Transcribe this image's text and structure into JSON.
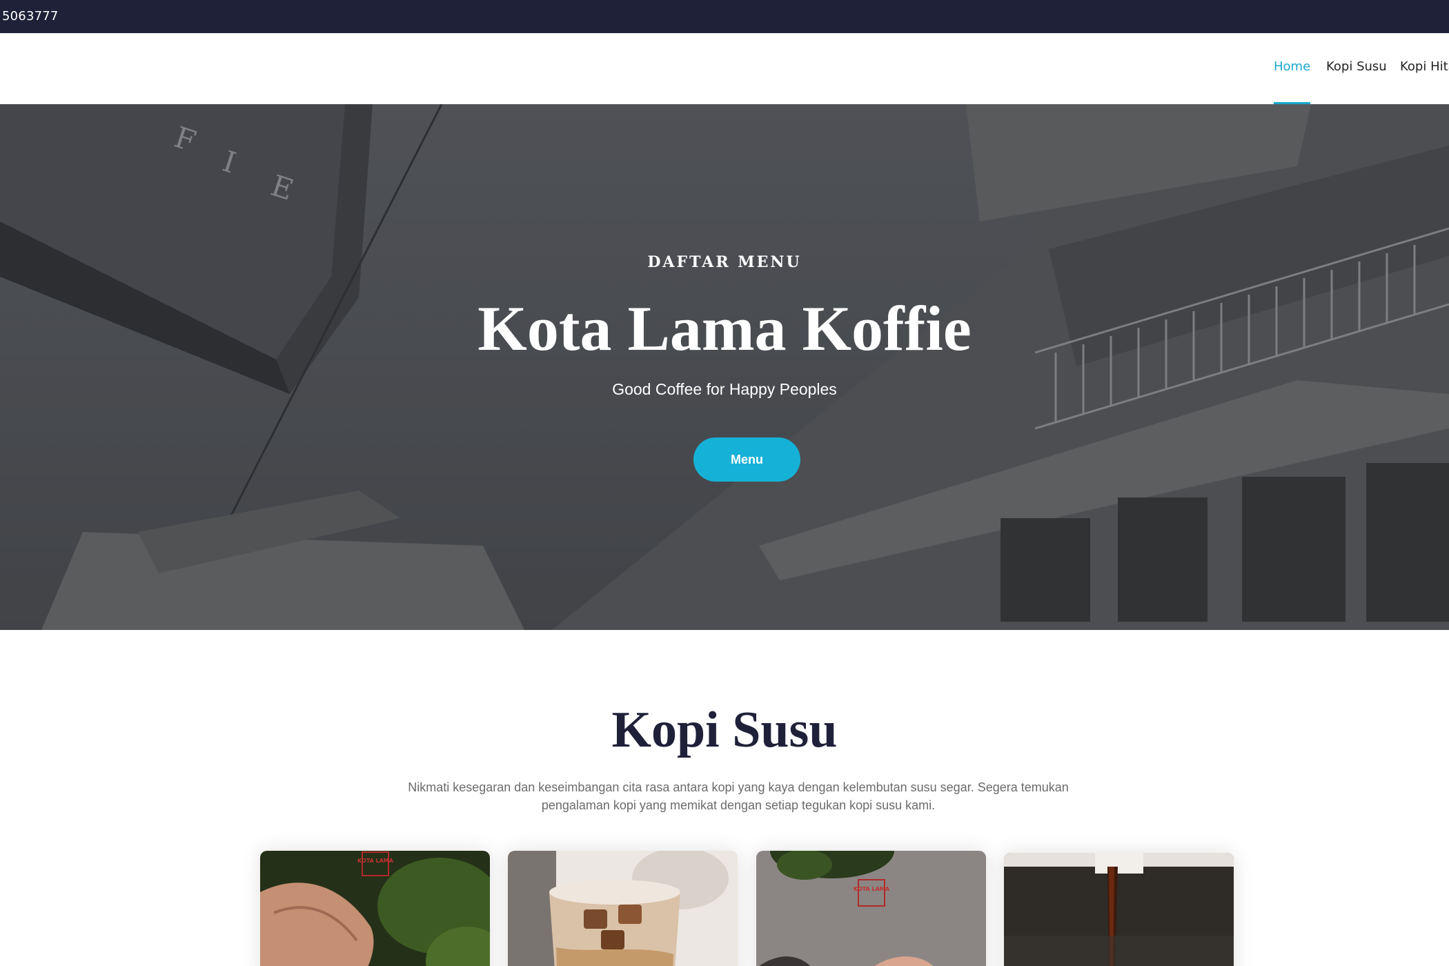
{
  "topbar": {
    "text": "5063777"
  },
  "nav": {
    "home": "Home",
    "kopi_susu": "Kopi Susu",
    "kopi_hitam": "Kopi Hita"
  },
  "hero": {
    "eyebrow": "DAFTAR MENU",
    "title": "Kota Lama Koffie",
    "subtitle": "Good Coffee for Happy Peoples",
    "button": "Menu"
  },
  "section": {
    "title": "Kopi Susu",
    "description_line1": "Nikmati kesegaran dan keseimbangan cita rasa antara kopi yang kaya dengan kelembutan susu segar. Segera temukan",
    "description_line2": "pengalaman kopi yang memikat dengan setiap tegukan kopi susu kami."
  },
  "cards": [
    {
      "logo": "KOTA LAMA",
      "icon": "hand-coffee-photo"
    },
    {
      "icon": "iced-coffee-photo"
    },
    {
      "logo": "KOTA LAMA",
      "icon": "hand-cup-photo"
    },
    {
      "icon": "espresso-drip-photo"
    }
  ],
  "colors": {
    "topbar": "#1f2139",
    "accent": "#16b1d6",
    "title": "#1f2139"
  }
}
